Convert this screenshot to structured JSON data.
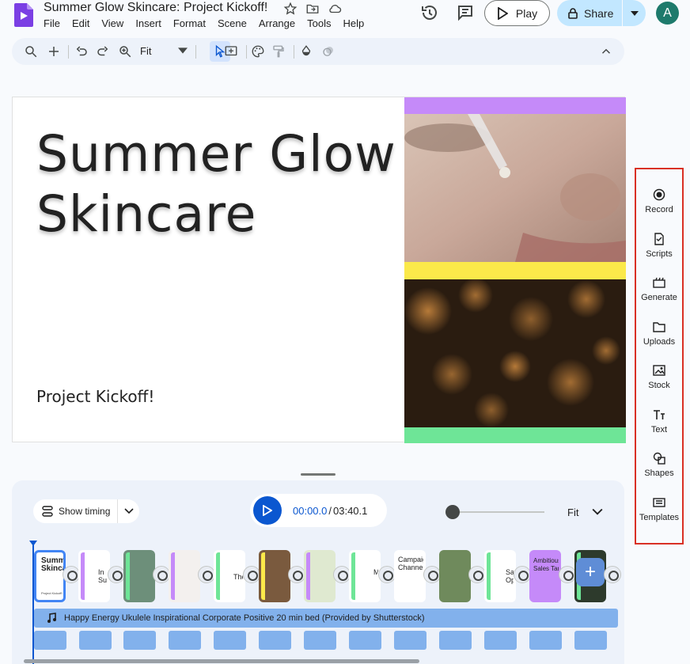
{
  "header": {
    "title": "Summer Glow Skincare: Project Kickoff!",
    "menu": [
      "File",
      "Edit",
      "View",
      "Insert",
      "Format",
      "Scene",
      "Arrange",
      "Tools",
      "Help"
    ],
    "play_label": "Play",
    "share_label": "Share",
    "avatar_letter": "A"
  },
  "toolbar": {
    "zoom_label": "Fit"
  },
  "slide": {
    "title_line1": "Summer Glow",
    "title_line2": "Skincare",
    "subtitle": "Project Kickoff!",
    "band_colors": [
      "#c58af9",
      "#fbe94a",
      "#6ee597"
    ]
  },
  "side_panel": {
    "items": [
      {
        "label": "Record",
        "icon": "record-icon"
      },
      {
        "label": "Scripts",
        "icon": "scripts-icon"
      },
      {
        "label": "Generate",
        "icon": "generate-icon"
      },
      {
        "label": "Uploads",
        "icon": "folder-icon"
      },
      {
        "label": "Stock",
        "icon": "stock-icon"
      },
      {
        "label": "Text",
        "icon": "text-icon"
      },
      {
        "label": "Shapes",
        "icon": "shapes-icon"
      },
      {
        "label": "Templates",
        "icon": "templates-icon"
      }
    ]
  },
  "timeline": {
    "show_timing_label": "Show timing",
    "current_time": "00:00.0",
    "total_time": "03:40.1",
    "fit_label": "Fit",
    "audio_track_label": "Happy Energy Ukulele Inspirational Corporate Positive 20 min bed (Provided by Shutterstock)",
    "scenes": [
      {
        "text": "Summe\nSkincar",
        "bar": "#4285f4"
      },
      {
        "text": "In\nSu",
        "bar": "#c58af9"
      },
      {
        "text": "",
        "bar": "#6ee597"
      },
      {
        "text": "",
        "bar": "#c58af9"
      },
      {
        "text": "The",
        "bar": "#6ee597"
      },
      {
        "text": "",
        "bar": "#fbe94a"
      },
      {
        "text": "",
        "bar": "#c58af9"
      },
      {
        "text": "M",
        "bar": "#6ee597"
      },
      {
        "text": "Campaig\nChannel",
        "bar": "#ffffff"
      },
      {
        "text": "",
        "bar": "#ffffff"
      },
      {
        "text": "Sa\nOp",
        "bar": "#6ee597"
      },
      {
        "text": "Ambitious\nSales Targ",
        "bar": "#c58af9"
      },
      {
        "text": "",
        "bar": "#6ee597"
      }
    ]
  }
}
